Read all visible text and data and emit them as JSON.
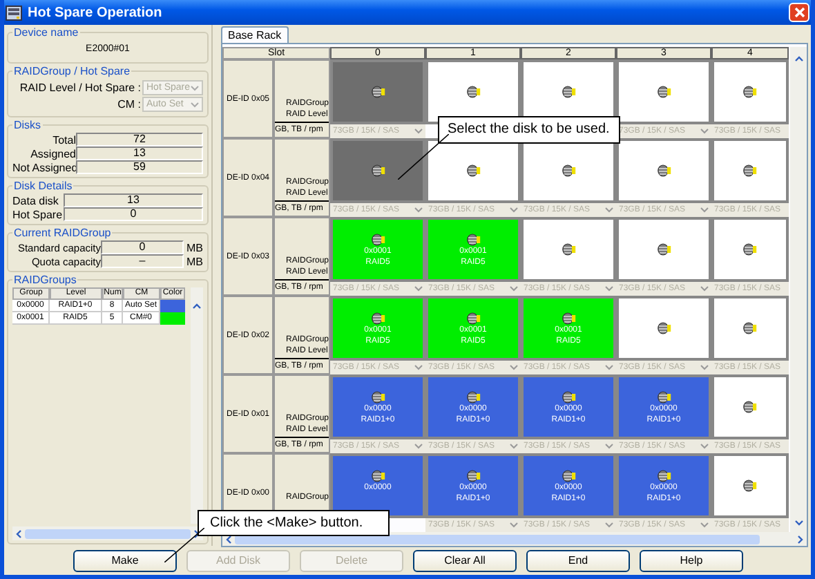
{
  "window": {
    "title": "Hot Spare Operation"
  },
  "device": {
    "legend": "Device name",
    "name": "E2000#01"
  },
  "raid_hot_spare": {
    "legend": "RAIDGroup / Hot Spare",
    "fields": [
      {
        "label": "RAID Level / Hot Spare :",
        "value": "Hot Spare",
        "disabled": true
      },
      {
        "label": "CM :",
        "value": "Auto Set",
        "disabled": true
      }
    ]
  },
  "disks": {
    "legend": "Disks",
    "fields": [
      {
        "label": "Total",
        "value": "72"
      },
      {
        "label": "Assigned",
        "value": "13"
      },
      {
        "label": "Not Assigned",
        "value": "59"
      }
    ]
  },
  "disk_details": {
    "legend": "Disk Details",
    "fields": [
      {
        "label": "Data disk",
        "value": "13"
      },
      {
        "label": "Hot Spare",
        "value": "0"
      }
    ]
  },
  "current_raidgroup": {
    "legend": "Current RAIDGroup",
    "fields": [
      {
        "label": "Standard capacity",
        "value": "0",
        "unit": "MB"
      },
      {
        "label": "Quota capacity",
        "value": "–",
        "unit": "MB"
      }
    ]
  },
  "raidgroups": {
    "legend": "RAIDGroups",
    "columns": [
      "Group",
      "Level",
      "Num",
      "CM",
      "Color"
    ],
    "rows": [
      {
        "group": "0x0000",
        "raid_level": "RAID1+0",
        "num": "8",
        "cm": "Auto Set",
        "color": "#3c64dc"
      },
      {
        "group": "0x0001",
        "raid_level": "RAID5",
        "num": "5",
        "cm": "CM#0",
        "color": "#00ee00"
      }
    ]
  },
  "tabs": [
    {
      "label": "Base Rack",
      "selected": true
    }
  ],
  "rack": {
    "slot_header": "Slot",
    "slots": [
      "0",
      "1",
      "2",
      "3",
      "4"
    ],
    "rows": [
      {
        "de_id": "DE-ID 0x05",
        "group_label": "RAIDGroup",
        "level_label": "RAID Level",
        "spec_label": "GB, TB / rpm",
        "cells": [
          {
            "kind": "selected",
            "spec": "73GB / 15K / SAS"
          },
          {
            "kind": "free"
          },
          {
            "kind": "free"
          },
          {
            "kind": "free",
            "spec": "73GB / 15K / SAS"
          },
          {
            "kind": "free",
            "spec": "73GB / 15K / SAS"
          }
        ]
      },
      {
        "de_id": "DE-ID 0x04",
        "group_label": "RAIDGroup",
        "level_label": "RAID Level",
        "spec_label": "GB, TB / rpm",
        "cells": [
          {
            "kind": "selected",
            "spec": "73GB / 15K / SAS"
          },
          {
            "kind": "free",
            "spec": "73GB / 15K / SAS"
          },
          {
            "kind": "free",
            "spec": "73GB / 15K / SAS"
          },
          {
            "kind": "free",
            "spec": "73GB / 15K / SAS"
          },
          {
            "kind": "free",
            "spec": "73GB / 15K / SAS"
          }
        ]
      },
      {
        "de_id": "DE-ID 0x03",
        "group_label": "RAIDGroup",
        "level_label": "RAID Level",
        "spec_label": "GB, TB / rpm",
        "cells": [
          {
            "kind": "assigned",
            "color": "#00ee00",
            "group": "0x0001",
            "raid_level": "RAID5",
            "spec": "73GB / 15K / SAS"
          },
          {
            "kind": "assigned",
            "color": "#00ee00",
            "group": "0x0001",
            "raid_level": "RAID5",
            "spec": "73GB / 15K / SAS"
          },
          {
            "kind": "free",
            "spec": "73GB / 15K / SAS"
          },
          {
            "kind": "free",
            "spec": "73GB / 15K / SAS"
          },
          {
            "kind": "free",
            "spec": "73GB / 15K / SAS"
          }
        ]
      },
      {
        "de_id": "DE-ID 0x02",
        "group_label": "RAIDGroup",
        "level_label": "RAID Level",
        "spec_label": "GB, TB / rpm",
        "cells": [
          {
            "kind": "assigned",
            "color": "#00ee00",
            "group": "0x0001",
            "raid_level": "RAID5",
            "spec": "73GB / 15K / SAS"
          },
          {
            "kind": "assigned",
            "color": "#00ee00",
            "group": "0x0001",
            "raid_level": "RAID5",
            "spec": "73GB / 15K / SAS"
          },
          {
            "kind": "assigned",
            "color": "#00ee00",
            "group": "0x0001",
            "raid_level": "RAID5",
            "spec": "73GB / 15K / SAS"
          },
          {
            "kind": "free",
            "spec": "73GB / 15K / SAS"
          },
          {
            "kind": "free",
            "spec": "73GB / 15K / SAS"
          }
        ]
      },
      {
        "de_id": "DE-ID 0x01",
        "group_label": "RAIDGroup",
        "level_label": "RAID Level",
        "spec_label": "GB, TB / rpm",
        "cells": [
          {
            "kind": "assigned",
            "color": "#3c64dc",
            "group": "0x0000",
            "raid_level": "RAID1+0",
            "spec": "73GB / 15K / SAS"
          },
          {
            "kind": "assigned",
            "color": "#3c64dc",
            "group": "0x0000",
            "raid_level": "RAID1+0",
            "spec": "73GB / 15K / SAS"
          },
          {
            "kind": "assigned",
            "color": "#3c64dc",
            "group": "0x0000",
            "raid_level": "RAID1+0",
            "spec": "73GB / 15K / SAS"
          },
          {
            "kind": "assigned",
            "color": "#3c64dc",
            "group": "0x0000",
            "raid_level": "RAID1+0",
            "spec": "73GB / 15K / SAS"
          },
          {
            "kind": "free",
            "spec": "73GB / 15K / SAS"
          }
        ]
      },
      {
        "de_id": "DE-ID 0x00",
        "group_label": "RAIDGroup",
        "cells": [
          {
            "kind": "assigned",
            "color": "#3c64dc",
            "group": "0x0000"
          },
          {
            "kind": "assigned",
            "color": "#3c64dc",
            "group": "0x0000",
            "raid_level": "RAID1+0",
            "spec": "73GB / 15K / SAS"
          },
          {
            "kind": "assigned",
            "color": "#3c64dc",
            "group": "0x0000",
            "raid_level": "RAID1+0",
            "spec": "73GB / 15K / SAS"
          },
          {
            "kind": "assigned",
            "color": "#3c64dc",
            "group": "0x0000",
            "raid_level": "RAID1+0",
            "spec": "73GB / 15K / SAS"
          },
          {
            "kind": "free",
            "spec": "73GB / 15K / SAS"
          }
        ]
      }
    ]
  },
  "buttons": [
    {
      "label": "Make",
      "disabled": false
    },
    {
      "label": "Add Disk",
      "disabled": true
    },
    {
      "label": "Delete",
      "disabled": true
    },
    {
      "label": "Clear All",
      "disabled": false
    },
    {
      "label": "End",
      "disabled": false
    },
    {
      "label": "Help",
      "disabled": false
    }
  ],
  "callouts": [
    {
      "text": "Select the disk to be used."
    },
    {
      "text": "Click the <Make> button."
    }
  ]
}
